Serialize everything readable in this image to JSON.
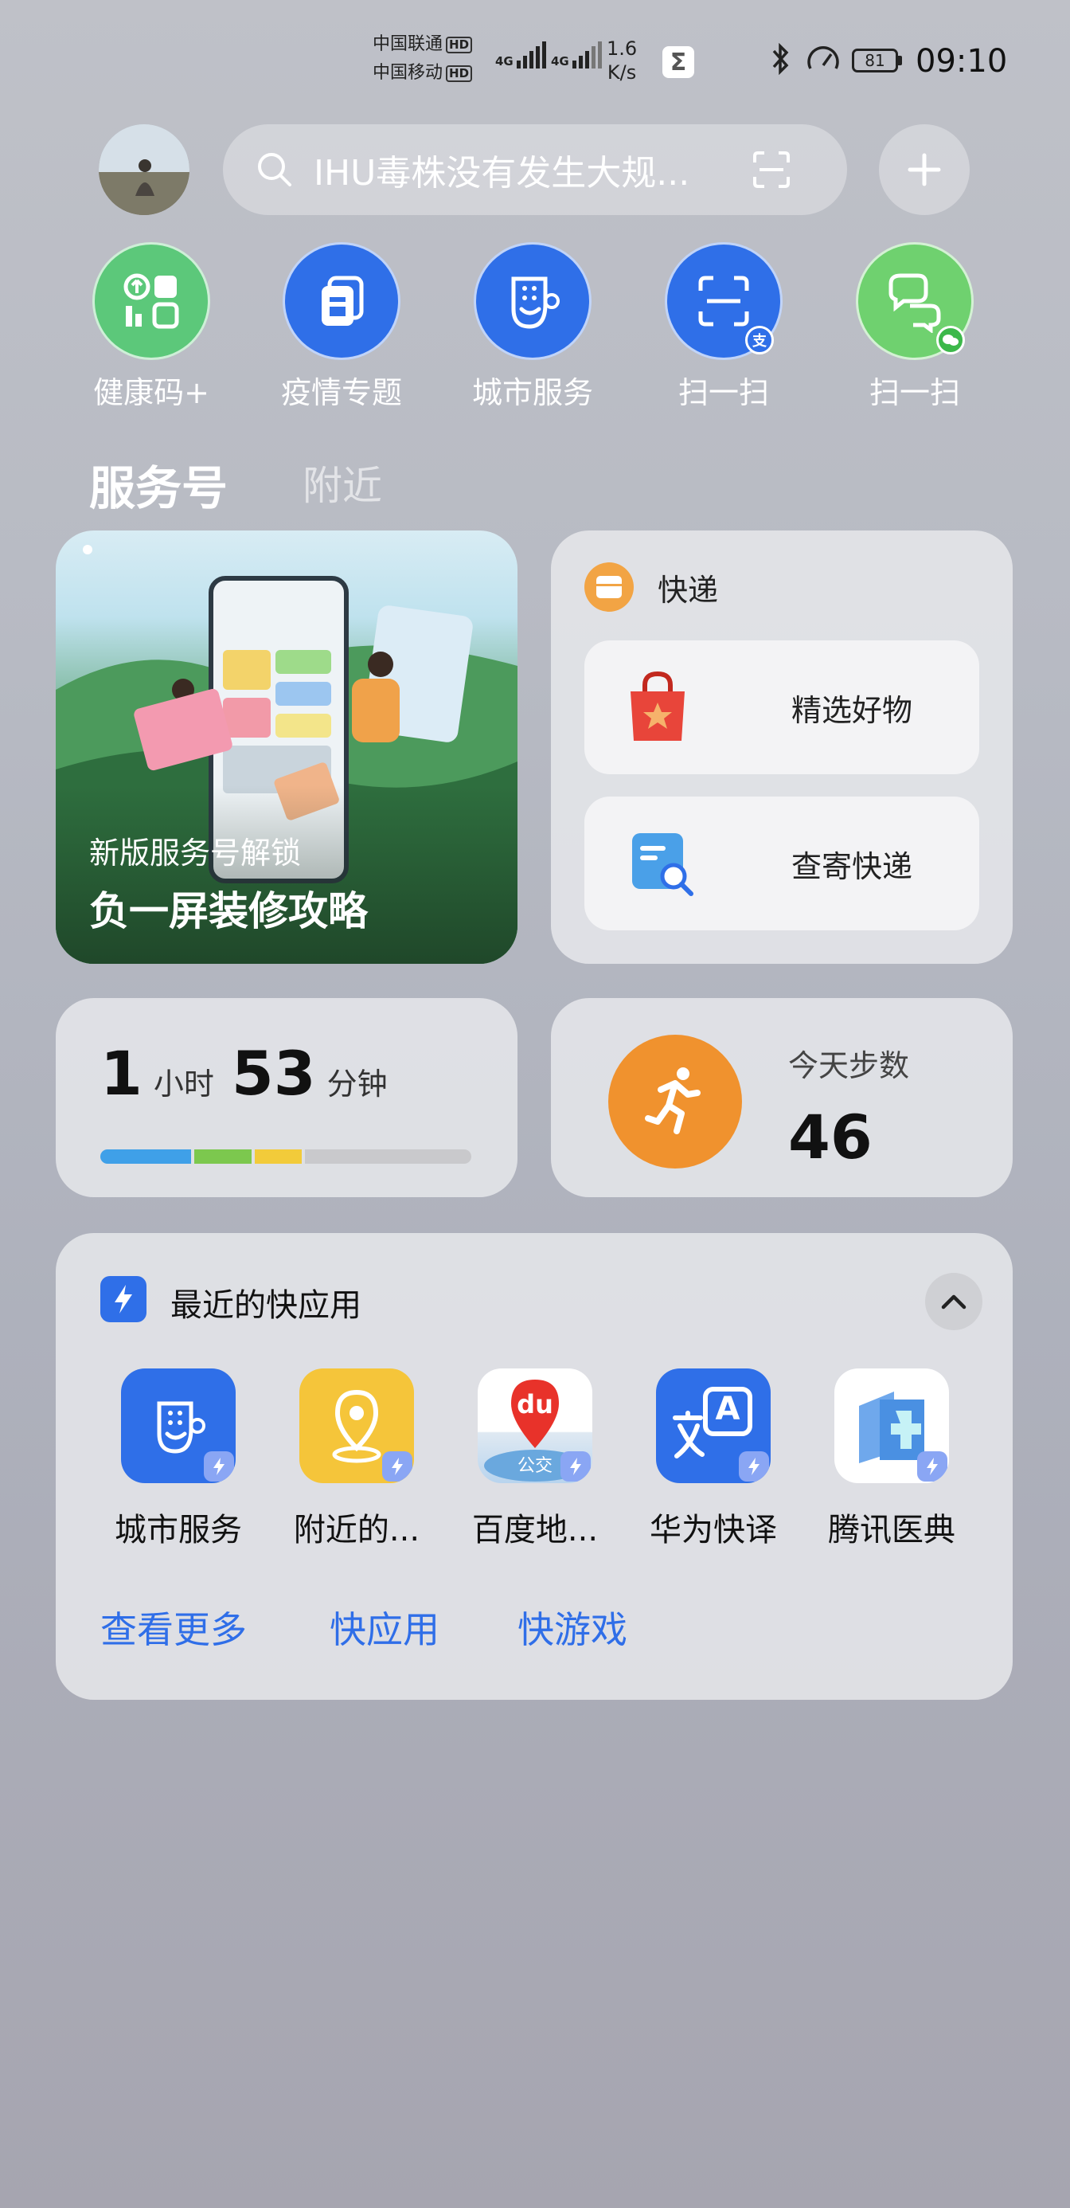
{
  "status_bar": {
    "carrier1": "中国联通",
    "carrier2": "中国移动",
    "hd": "HD",
    "net": "4G",
    "speed_value": "1.6",
    "speed_unit": "K/s",
    "battery": "81",
    "time": "09:10"
  },
  "search": {
    "placeholder": "IHU毒株没有发生大规..."
  },
  "quick_actions": [
    {
      "label": "健康码+",
      "color": "#5cc87a",
      "icon": "health-code-icon"
    },
    {
      "label": "疫情专题",
      "color": "#2f6fe8",
      "icon": "epidemic-topic-icon"
    },
    {
      "label": "城市服务",
      "color": "#2f6fe8",
      "icon": "city-service-icon"
    },
    {
      "label": "扫一扫",
      "color": "#2f6fe8",
      "icon": "scan-icon",
      "badge": "支"
    },
    {
      "label": "扫一扫",
      "color": "#6fd16f",
      "icon": "wechat-scan-icon"
    }
  ],
  "tabs": {
    "active": "服务号",
    "other": "附近"
  },
  "promo": {
    "subtitle": "新版服务号解锁",
    "title": "负一屏装修攻略"
  },
  "express": {
    "title": "快递",
    "items": [
      {
        "label": "精选好物"
      },
      {
        "label": "查寄快递"
      }
    ]
  },
  "screen_time": {
    "hours": "1",
    "hours_unit": "小时",
    "minutes": "53",
    "minutes_unit": "分钟",
    "segments": [
      {
        "color": "#3fa0e8",
        "fraction": 0.25
      },
      {
        "color": "#7cc84e",
        "fraction": 0.16
      },
      {
        "color": "#f2cb3a",
        "fraction": 0.13
      },
      {
        "color": "#c9c9cc",
        "fraction": 0.46
      }
    ]
  },
  "steps": {
    "label": "今天步数",
    "value": "46"
  },
  "recent_apps": {
    "title": "最近的快应用",
    "apps": [
      {
        "label": "城市服务",
        "icon": "city-service-app-icon"
      },
      {
        "label": "附近的...",
        "icon": "nearby-location-icon"
      },
      {
        "label": "百度地...",
        "icon": "baidu-map-icon",
        "text": "du",
        "sub": "公交"
      },
      {
        "label": "华为快译",
        "icon": "translate-icon",
        "text": "A"
      },
      {
        "label": "腾讯医典",
        "icon": "medical-book-icon"
      }
    ],
    "links": [
      "查看更多",
      "快应用",
      "快游戏"
    ]
  }
}
